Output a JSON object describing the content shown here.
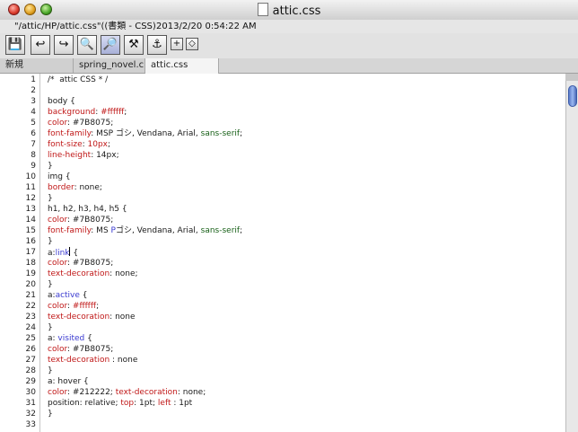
{
  "window": {
    "title": "attic.css"
  },
  "info": {
    "path": "\"/attic/HP/attic.css\"((書類 - CSS)",
    "timestamp": "2013/2/20  0:54:22 AM"
  },
  "toolbar": {
    "buttons": [
      "save-icon",
      "undo-icon",
      "redo-icon",
      "find-icon",
      "find-replace-icon",
      "multi-search-icon",
      "multi-replace-icon"
    ],
    "small": [
      "plus-icon",
      "diamond-icon"
    ]
  },
  "tabs": [
    "新規",
    "spring_novel.c",
    "attic.css"
  ],
  "editor": {
    "lines": [
      {
        "n": "1",
        "parts": [
          {
            "t": "/*  attic CSS * /",
            "c": ""
          }
        ]
      },
      {
        "n": "2",
        "parts": []
      },
      {
        "n": "3",
        "parts": [
          {
            "t": "body {",
            "c": ""
          }
        ]
      },
      {
        "n": "4",
        "parts": [
          {
            "t": "background",
            "c": "kw"
          },
          {
            "t": ": ",
            "c": ""
          },
          {
            "t": "#ffffff",
            "c": "kw"
          },
          {
            "t": ";",
            "c": ""
          }
        ]
      },
      {
        "n": "5",
        "parts": [
          {
            "t": "color",
            "c": "kw"
          },
          {
            "t": ": #7B8075;",
            "c": ""
          }
        ]
      },
      {
        "n": "6",
        "parts": [
          {
            "t": "font-family",
            "c": "kw"
          },
          {
            "t": ": MSP ゴシ, Vendana, Arial, ",
            "c": ""
          },
          {
            "t": "sans-serif",
            "c": "ff"
          },
          {
            "t": ";",
            "c": ""
          }
        ]
      },
      {
        "n": "7",
        "parts": [
          {
            "t": "font-size",
            "c": "kw"
          },
          {
            "t": ": ",
            "c": ""
          },
          {
            "t": "10px",
            "c": "kw"
          },
          {
            "t": ";",
            "c": ""
          }
        ]
      },
      {
        "n": "8",
        "parts": [
          {
            "t": "line-height",
            "c": "kw"
          },
          {
            "t": ": 14px;",
            "c": ""
          }
        ]
      },
      {
        "n": "9",
        "parts": [
          {
            "t": "}",
            "c": ""
          }
        ]
      },
      {
        "n": "10",
        "parts": [
          {
            "t": "img {",
            "c": ""
          }
        ]
      },
      {
        "n": "11",
        "parts": [
          {
            "t": "border",
            "c": "kw"
          },
          {
            "t": ": none;",
            "c": ""
          }
        ]
      },
      {
        "n": "12",
        "parts": [
          {
            "t": "}",
            "c": ""
          }
        ]
      },
      {
        "n": "13",
        "parts": [
          {
            "t": "h1, h2, h3, h4, h5 {",
            "c": ""
          }
        ]
      },
      {
        "n": "14",
        "parts": [
          {
            "t": "color",
            "c": "kw"
          },
          {
            "t": ": #7B8075;",
            "c": ""
          }
        ]
      },
      {
        "n": "15",
        "parts": [
          {
            "t": "font-family",
            "c": "kw"
          },
          {
            "t": ": MS ",
            "c": ""
          },
          {
            "t": "P",
            "c": "sel"
          },
          {
            "t": "ゴシ, Vendana, Arial, ",
            "c": ""
          },
          {
            "t": "sans-serif",
            "c": "ff"
          },
          {
            "t": ";",
            "c": ""
          }
        ]
      },
      {
        "n": "16",
        "parts": [
          {
            "t": "}",
            "c": ""
          }
        ]
      },
      {
        "n": "17",
        "parts": [
          {
            "t": "a:",
            "c": ""
          },
          {
            "t": "link",
            "c": "sel"
          },
          {
            "t": " {",
            "c": ""
          }
        ]
      },
      {
        "n": "18",
        "parts": [
          {
            "t": "color",
            "c": "kw"
          },
          {
            "t": ": #7B8075;",
            "c": ""
          }
        ]
      },
      {
        "n": "19",
        "parts": [
          {
            "t": "text-decoration",
            "c": "kw"
          },
          {
            "t": ": none;",
            "c": ""
          }
        ]
      },
      {
        "n": "20",
        "parts": [
          {
            "t": "}",
            "c": ""
          }
        ]
      },
      {
        "n": "21",
        "parts": [
          {
            "t": "a:",
            "c": ""
          },
          {
            "t": "active",
            "c": "sel"
          },
          {
            "t": " {",
            "c": ""
          }
        ]
      },
      {
        "n": "22",
        "parts": [
          {
            "t": "color",
            "c": "kw"
          },
          {
            "t": ": ",
            "c": ""
          },
          {
            "t": "#ffffff",
            "c": "kw"
          },
          {
            "t": ";",
            "c": ""
          }
        ]
      },
      {
        "n": "23",
        "parts": [
          {
            "t": "text-decoration",
            "c": "kw"
          },
          {
            "t": ": none",
            "c": ""
          }
        ]
      },
      {
        "n": "24",
        "parts": [
          {
            "t": "}",
            "c": ""
          }
        ]
      },
      {
        "n": "25",
        "parts": [
          {
            "t": "a: ",
            "c": ""
          },
          {
            "t": "visited",
            "c": "sel"
          },
          {
            "t": " {",
            "c": ""
          }
        ]
      },
      {
        "n": "26",
        "parts": [
          {
            "t": "color",
            "c": "kw"
          },
          {
            "t": ": #7B8075;",
            "c": ""
          }
        ]
      },
      {
        "n": "27",
        "parts": [
          {
            "t": "text-decoration",
            "c": "kw"
          },
          {
            "t": " : none",
            "c": ""
          }
        ]
      },
      {
        "n": "28",
        "parts": [
          {
            "t": "}",
            "c": ""
          }
        ]
      },
      {
        "n": "29",
        "parts": [
          {
            "t": "a: hover {",
            "c": ""
          }
        ]
      },
      {
        "n": "30",
        "parts": [
          {
            "t": "color",
            "c": "kw"
          },
          {
            "t": ": #212222; ",
            "c": ""
          },
          {
            "t": "text-decoration",
            "c": "kw"
          },
          {
            "t": ": none;",
            "c": ""
          }
        ]
      },
      {
        "n": "31",
        "parts": [
          {
            "t": "position: relative; ",
            "c": ""
          },
          {
            "t": "top",
            "c": "kw"
          },
          {
            "t": ": 1pt; ",
            "c": ""
          },
          {
            "t": "left",
            "c": "kw"
          },
          {
            "t": " : 1pt",
            "c": ""
          }
        ]
      },
      {
        "n": "32",
        "parts": [
          {
            "t": "}",
            "c": ""
          }
        ]
      },
      {
        "n": "33",
        "parts": []
      }
    ]
  }
}
